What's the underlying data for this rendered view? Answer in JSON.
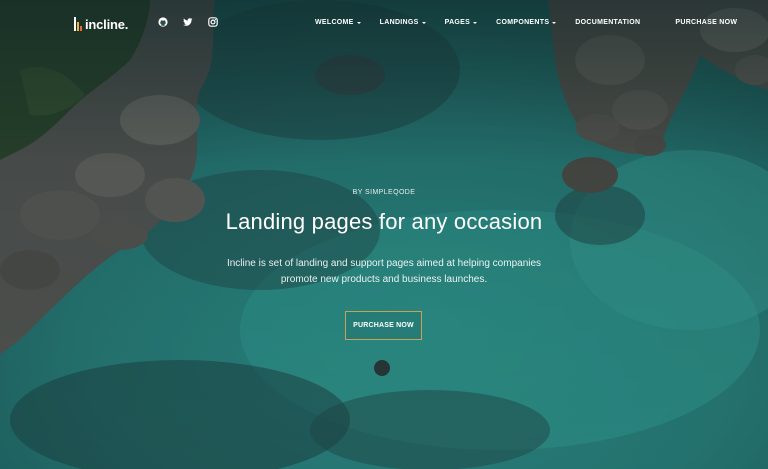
{
  "brand": {
    "name": "incline.",
    "logo_icon": "incline-logo-mark"
  },
  "social": [
    {
      "icon": "github-icon"
    },
    {
      "icon": "twitter-icon"
    },
    {
      "icon": "instagram-icon"
    }
  ],
  "nav": {
    "items": [
      {
        "label": "WELCOME"
      },
      {
        "label": "LANDINGS"
      },
      {
        "label": "PAGES"
      },
      {
        "label": "COMPONENTS"
      },
      {
        "label": "DOCUMENTATION"
      }
    ],
    "purchase_label": "PURCHASE NOW"
  },
  "hero": {
    "eyebrow": "BY SIMPLEQODE",
    "title": "Landing pages for any occasion",
    "description": "Incline is set of landing and support pages aimed at helping companies promote new products and business launches.",
    "cta_label": "PURCHASE NOW"
  },
  "colors": {
    "water": "#2a8f8a",
    "rock": "#5d5a56",
    "cta_border": "#c9a15b"
  }
}
